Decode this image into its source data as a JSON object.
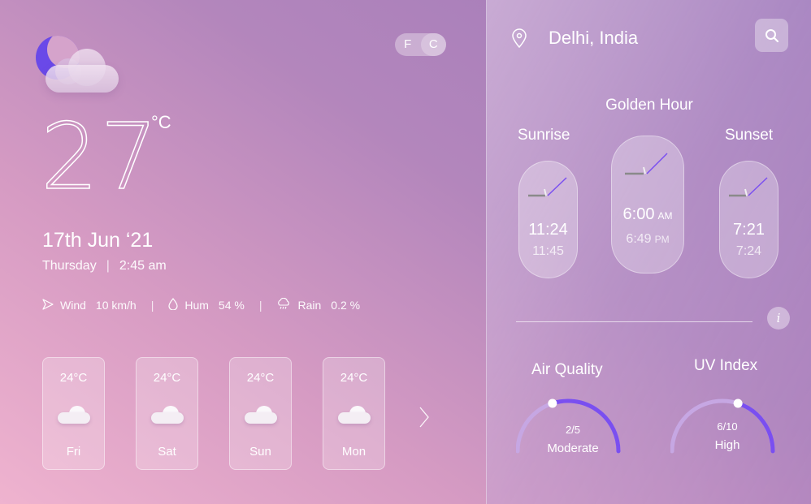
{
  "left": {
    "unit_toggle": {
      "f": "F",
      "c": "C",
      "selected": "C"
    },
    "temperature": "27",
    "temperature_unit": "°C",
    "date": "17th Jun ‘21",
    "day": "Thursday",
    "separator": "|",
    "time": "2:45 am",
    "stats": {
      "wind_label": "Wind",
      "wind_value": "10 km/h",
      "hum_label": "Hum",
      "hum_value": "54 %",
      "rain_label": "Rain",
      "rain_value": "0.2 %",
      "separator": "|"
    },
    "forecast": [
      {
        "temp": "24°C",
        "day": "Fri",
        "icon": "cloud-icon"
      },
      {
        "temp": "24°C",
        "day": "Sat",
        "icon": "cloud-icon"
      },
      {
        "temp": "24°C",
        "day": "Sun",
        "icon": "cloud-icon"
      },
      {
        "temp": "24°C",
        "day": "Mon",
        "icon": "cloud-icon"
      }
    ],
    "main_icon": "moon-cloud-icon"
  },
  "right": {
    "location": "Delhi, India",
    "golden_hour_title": "Golden Hour",
    "sunrise_title": "Sunrise",
    "sunset_title": "Sunset",
    "sunrise": {
      "time1": "11:24",
      "time2": "11:45"
    },
    "golden": {
      "time1": "6:00",
      "ampm1": "AM",
      "time2": "6:49",
      "ampm2": "PM"
    },
    "sunset": {
      "time1": "7:21",
      "time2": "7:24"
    },
    "info_label": "i",
    "air_quality": {
      "title": "Air Quality",
      "value": "2/5",
      "level": "Moderate",
      "fraction": 0.4
    },
    "uv_index": {
      "title": "UV Index",
      "value": "6/10",
      "level": "High",
      "fraction": 0.6
    }
  },
  "colors": {
    "accent": "#6a49e8",
    "gauge_track": "#c6a7e3",
    "gauge_fill": "#7a4ff0"
  }
}
